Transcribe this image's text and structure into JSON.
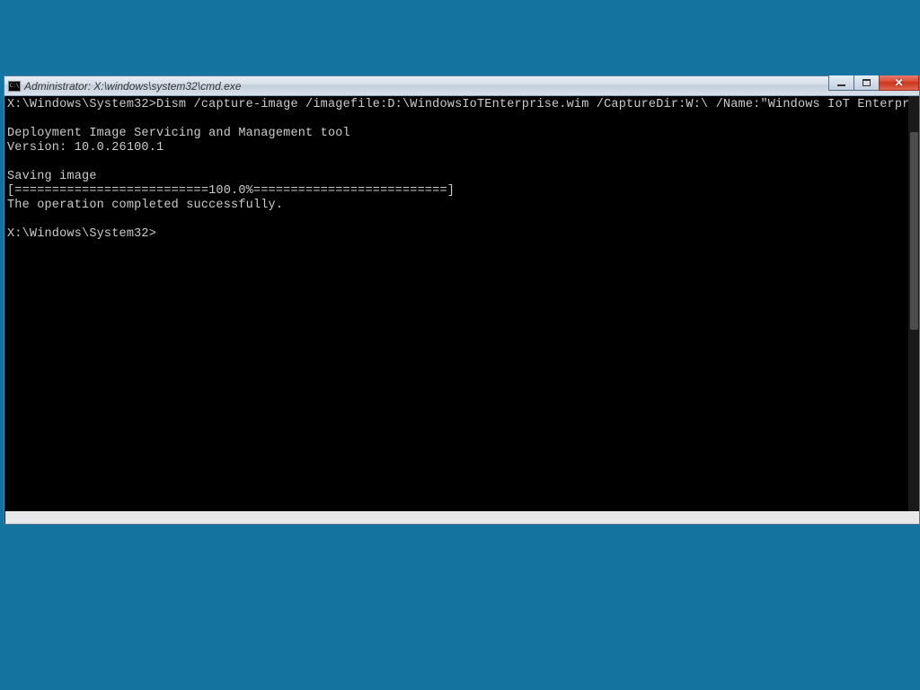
{
  "window": {
    "title": "Administrator: X:\\windows\\system32\\cmd.exe",
    "icon_label": "C:\\"
  },
  "terminal": {
    "line_prompt1": "X:\\Windows\\System32>",
    "line_command": "Dism /capture-image /imagefile:D:\\WindowsIoTEnterprise.wim /CaptureDir:W:\\ /Name:\"Windows IoT Enterprise\"",
    "line_blank_a": "",
    "line_tool": "Deployment Image Servicing and Management tool",
    "line_version": "Version: 10.0.26100.1",
    "line_blank_b": "",
    "line_saving": "Saving image",
    "line_progress": "[==========================100.0%==========================]",
    "line_success": "The operation completed successfully.",
    "line_blank_c": "",
    "line_prompt2": "X:\\Windows\\System32>"
  }
}
